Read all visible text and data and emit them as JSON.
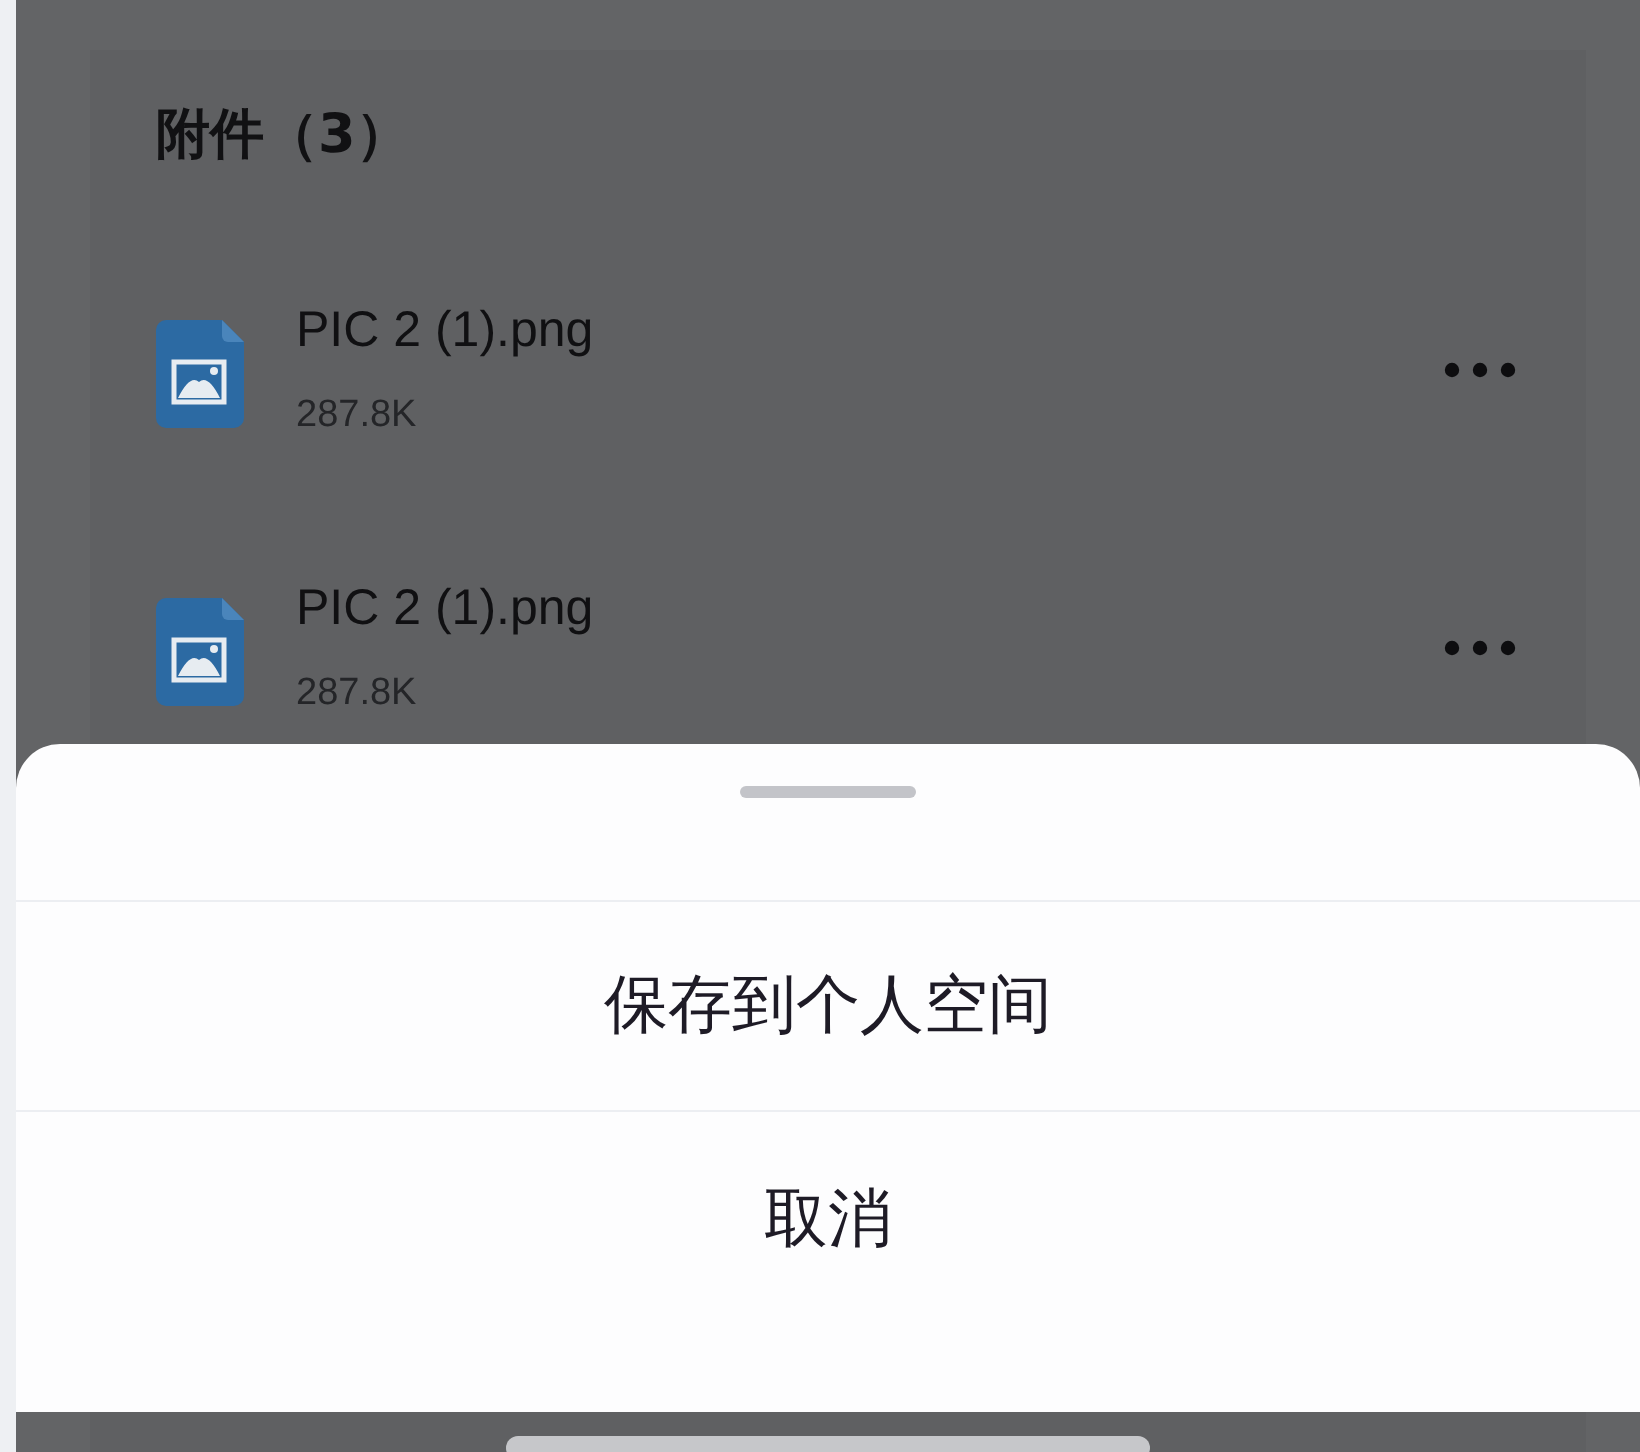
{
  "attachments": {
    "title": "附件（3）",
    "files": [
      {
        "name": "PIC 2 (1).png",
        "size": "287.8K"
      },
      {
        "name": "PIC 2 (1).png",
        "size": "287.8K"
      }
    ]
  },
  "action_sheet": {
    "options": [
      {
        "label": "保存到个人空间"
      },
      {
        "label": "取消"
      }
    ]
  }
}
